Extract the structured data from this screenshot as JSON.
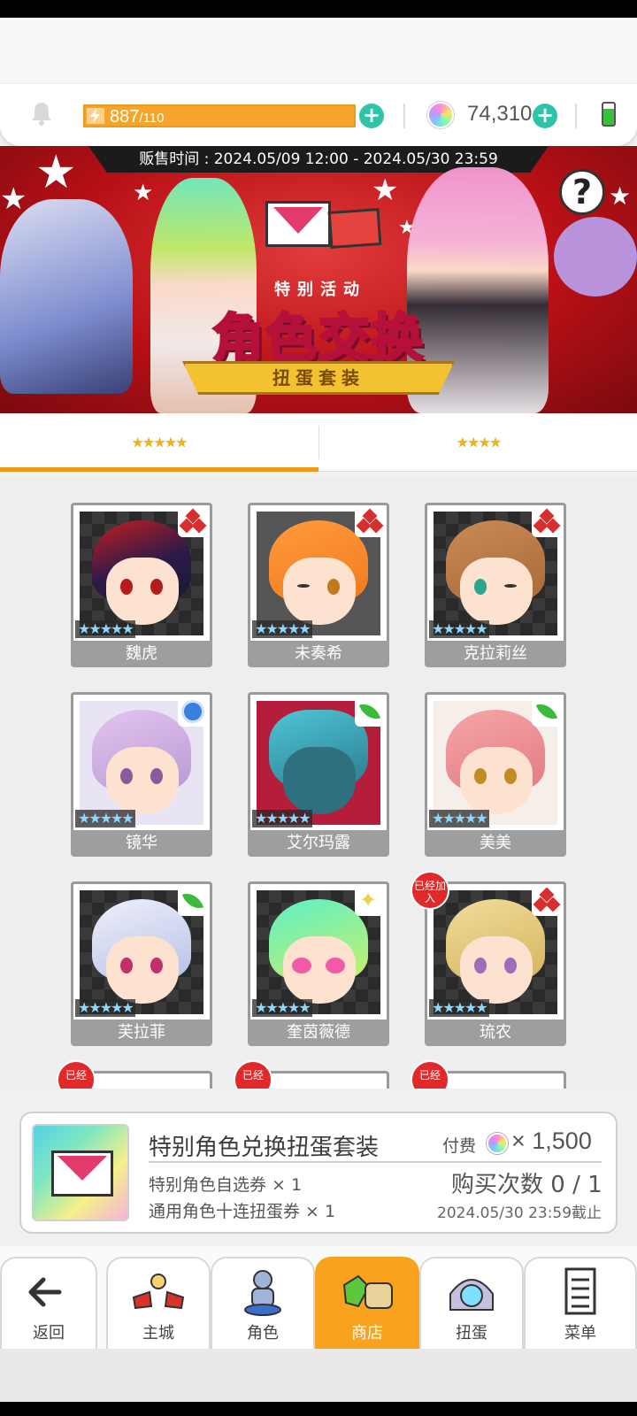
{
  "resources": {
    "stamina_current": "887",
    "stamina_max": "/110",
    "gems": "74,310"
  },
  "banner": {
    "sale_time": "贩售时间 : 2024.05/09 12:00 - 2024.05/30 23:59",
    "badge": "特别活动",
    "title": "角色交换",
    "subtitle": "扭蛋套装",
    "help": "?"
  },
  "tabs": [
    {
      "label": "★★★★★",
      "active": true
    },
    {
      "label": "★★★★",
      "active": false
    }
  ],
  "characters": [
    {
      "name": "魏虎",
      "rarity": "★★★★★",
      "attribute": "diamond-red"
    },
    {
      "name": "未奏希",
      "rarity": "★★★★★",
      "attribute": "diamond-red"
    },
    {
      "name": "克拉莉丝",
      "rarity": "★★★★★",
      "attribute": "diamond-red"
    },
    {
      "name": "镜华",
      "rarity": "★★★★★",
      "attribute": "circle-blue"
    },
    {
      "name": "艾尔玛露",
      "rarity": "★★★★★",
      "attribute": "leaf-green"
    },
    {
      "name": "美美",
      "rarity": "★★★★★",
      "attribute": "leaf-green"
    },
    {
      "name": "芙拉菲",
      "rarity": "★★★★★",
      "attribute": "leaf-green"
    },
    {
      "name": "奎茵薇德",
      "rarity": "★★★★★",
      "attribute": "spark-yellow"
    },
    {
      "name": "琉农",
      "rarity": "★★★★★",
      "attribute": "diamond-red",
      "badge": "已经加入"
    }
  ],
  "partial_badges": [
    "已经",
    "已经",
    "已经"
  ],
  "product": {
    "title": "特别角色兑换扭蛋套装",
    "item1": "特别角色自选券 × 1",
    "item2": "通用角色十连扭蛋券 × 1",
    "price_label": "付费",
    "price_value": "× 1,500",
    "purchase_count": "购买次数 0 / 1",
    "deadline": "2024.05/30 23:59截止"
  },
  "nav": {
    "back": "返回",
    "home": "主城",
    "characters": "角色",
    "shop": "商店",
    "gacha": "扭蛋",
    "menu": "菜单"
  },
  "colors": {
    "accent": "#f8a21e",
    "teal": "#2fc4a7",
    "banner_red": "#b81016"
  }
}
